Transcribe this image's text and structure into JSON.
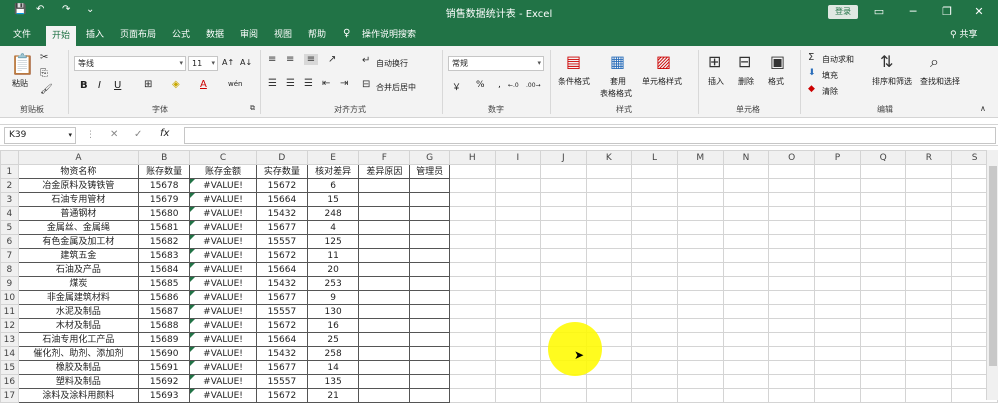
{
  "window": {
    "title": "销售数据统计表 - Excel",
    "login_label": "登录",
    "controls": {
      "restore": "▭",
      "minimize": "─",
      "maximize": "❐",
      "close": "✕"
    },
    "quick_access": {
      "save": "💾",
      "undo": "↶",
      "redo": "↷",
      "customize": "⌄"
    }
  },
  "menu": {
    "tabs": [
      "文件",
      "开始",
      "插入",
      "页面布局",
      "公式",
      "数据",
      "审阅",
      "视图",
      "帮助"
    ],
    "active_tab": "开始",
    "tell_me": "操作说明搜索",
    "share": "共享"
  },
  "ribbon": {
    "clipboard": {
      "label": "剪贴板",
      "paste": "粘贴"
    },
    "font": {
      "label": "字体",
      "font_name": "等线",
      "font_size": "11",
      "bold": "B",
      "italic": "I",
      "underline": "U",
      "grow": "A↑",
      "shrink": "A↓",
      "fill": "◈",
      "color": "A",
      "border": "⊞",
      "wen": "wén"
    },
    "alignment": {
      "label": "对齐方式",
      "wrap": "自动换行",
      "merge": "合并后居中"
    },
    "number": {
      "label": "数字",
      "format": "常规",
      "currency": "￥",
      "percent": "%",
      "comma": ",",
      "inc": "←.0",
      "dec": ".00→"
    },
    "styles": {
      "label": "样式",
      "conditional": "条件格式",
      "table_fmt_1": "套用",
      "table_fmt_2": "表格格式",
      "cell_styles": "单元格样式"
    },
    "cells": {
      "label": "单元格",
      "insert": "插入",
      "delete": "删除",
      "format": "格式"
    },
    "editing": {
      "label": "编辑",
      "autosum": "自动求和",
      "fill": "填充",
      "clear": "清除",
      "sort": "排序和筛选",
      "find": "查找和选择"
    }
  },
  "formula_bar": {
    "name_box": "K39",
    "cancel": "✕",
    "enter": "✓",
    "fx": "fx",
    "value": ""
  },
  "columns": [
    "A",
    "B",
    "C",
    "D",
    "E",
    "F",
    "G",
    "H",
    "I",
    "J",
    "K",
    "L",
    "M",
    "N",
    "O",
    "P",
    "Q",
    "R",
    "S"
  ],
  "header_row": [
    "物资名称",
    "账存数量",
    "账存金额",
    "实存数量",
    "核对差异",
    "差异原因",
    "管理员"
  ],
  "rows": [
    {
      "n": "2",
      "name": "冶金原料及铸铁管",
      "qty": "15678",
      "amount": "#VALUE!",
      "actual": "15672",
      "diff": "6"
    },
    {
      "n": "3",
      "name": "石油专用管材",
      "qty": "15679",
      "amount": "#VALUE!",
      "actual": "15664",
      "diff": "15"
    },
    {
      "n": "4",
      "name": "普通钢材",
      "qty": "15680",
      "amount": "#VALUE!",
      "actual": "15432",
      "diff": "248"
    },
    {
      "n": "5",
      "name": "金属丝、金属绳",
      "qty": "15681",
      "amount": "#VALUE!",
      "actual": "15677",
      "diff": "4"
    },
    {
      "n": "6",
      "name": "有色金属及加工材",
      "qty": "15682",
      "amount": "#VALUE!",
      "actual": "15557",
      "diff": "125"
    },
    {
      "n": "7",
      "name": "建筑五金",
      "qty": "15683",
      "amount": "#VALUE!",
      "actual": "15672",
      "diff": "11"
    },
    {
      "n": "8",
      "name": "石油及产品",
      "qty": "15684",
      "amount": "#VALUE!",
      "actual": "15664",
      "diff": "20"
    },
    {
      "n": "9",
      "name": "煤炭",
      "qty": "15685",
      "amount": "#VALUE!",
      "actual": "15432",
      "diff": "253"
    },
    {
      "n": "10",
      "name": "非金属建筑材料",
      "qty": "15686",
      "amount": "#VALUE!",
      "actual": "15677",
      "diff": "9"
    },
    {
      "n": "11",
      "name": "水泥及制品",
      "qty": "15687",
      "amount": "#VALUE!",
      "actual": "15557",
      "diff": "130"
    },
    {
      "n": "12",
      "name": "木材及制品",
      "qty": "15688",
      "amount": "#VALUE!",
      "actual": "15672",
      "diff": "16"
    },
    {
      "n": "13",
      "name": "石油专用化工产品",
      "qty": "15689",
      "amount": "#VALUE!",
      "actual": "15664",
      "diff": "25"
    },
    {
      "n": "14",
      "name": "催化剂、助剂、添加剂",
      "qty": "15690",
      "amount": "#VALUE!",
      "actual": "15432",
      "diff": "258"
    },
    {
      "n": "15",
      "name": "橡胶及制品",
      "qty": "15691",
      "amount": "#VALUE!",
      "actual": "15677",
      "diff": "14"
    },
    {
      "n": "16",
      "name": "塑料及制品",
      "qty": "15692",
      "amount": "#VALUE!",
      "actual": "15557",
      "diff": "135"
    },
    {
      "n": "17",
      "name": "涂料及涂料用颜料",
      "qty": "15693",
      "amount": "#VALUE!",
      "actual": "15672",
      "diff": "21"
    }
  ],
  "colors": {
    "excel_green": "#217346",
    "cursor_highlight": "#fff700"
  }
}
